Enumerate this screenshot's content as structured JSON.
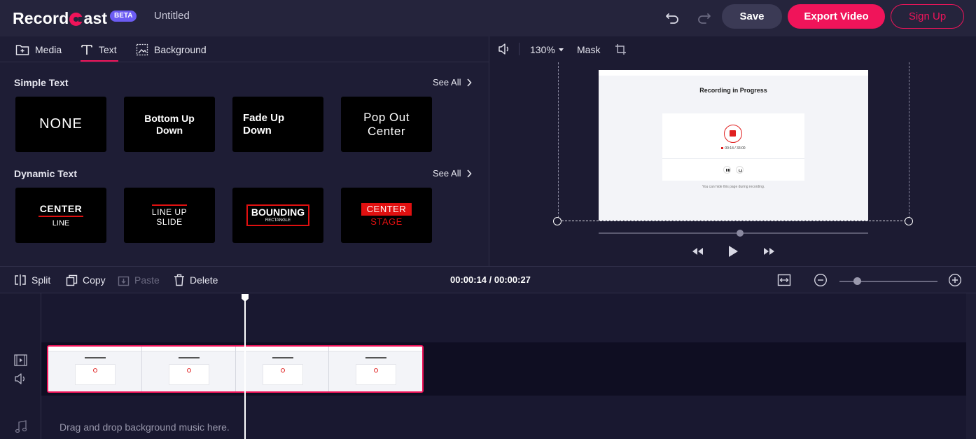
{
  "app": {
    "logo_prefix": "Record",
    "logo_suffix": "ast",
    "beta": "BETA",
    "doc_title": "Untitled"
  },
  "header": {
    "save": "Save",
    "export": "Export Video",
    "signup": "Sign Up"
  },
  "tabs": [
    {
      "label": "Media",
      "icon": "media-add-icon"
    },
    {
      "label": "Text",
      "icon": "text-icon",
      "active": true
    },
    {
      "label": "Background",
      "icon": "background-icon"
    }
  ],
  "simple_text": {
    "title": "Simple Text",
    "see_all": "See All",
    "cards": [
      {
        "line1": "NONE",
        "line2": ""
      },
      {
        "line1": "Bottom Up",
        "line2": "Down"
      },
      {
        "line1": "Fade Up",
        "line2": "Down"
      },
      {
        "line1": "Pop Out",
        "line2": "Center"
      }
    ]
  },
  "dynamic_text": {
    "title": "Dynamic Text",
    "see_all": "See All",
    "cards": [
      {
        "line1": "CENTER",
        "line2": "LINE"
      },
      {
        "line1": "LINE UP",
        "line2": "SLIDE"
      },
      {
        "line1": "BOUNDING",
        "line2": "RECTANGLE"
      },
      {
        "line1": "CENTER",
        "line2": "STAGE"
      }
    ]
  },
  "preview": {
    "zoom": "130%",
    "mask": "Mask",
    "frame_title": "Recording in Progress",
    "frame_timer": "00:14 / 33:00",
    "frame_hint": "You can hide this page during recording."
  },
  "timeline_toolbar": {
    "split": "Split",
    "copy": "Copy",
    "paste": "Paste",
    "delete": "Delete",
    "timecode": "00:00:14 / 00:00:27"
  },
  "timeline": {
    "music_hint": "Drag and drop background music here."
  },
  "colors": {
    "accent": "#f0145a",
    "beta": "#6c5cf3",
    "bg": "#1b1a30"
  }
}
